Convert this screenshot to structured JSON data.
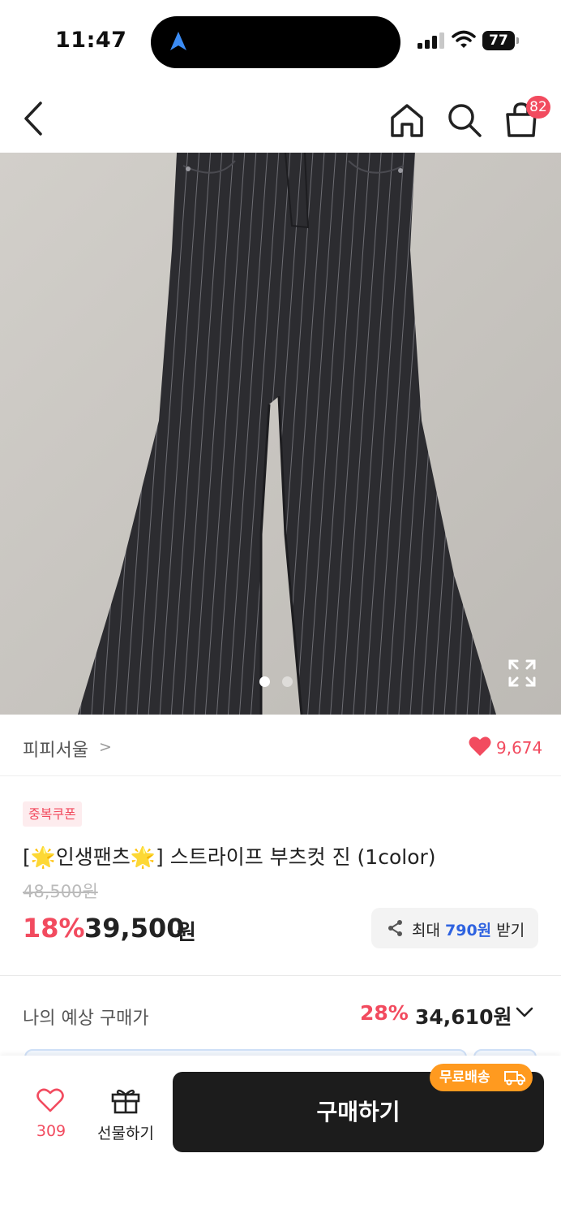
{
  "status_bar": {
    "time": "11:47",
    "battery": "77",
    "icons": [
      "location-arrow-icon",
      "signal-icon",
      "wifi-icon",
      "battery-icon"
    ]
  },
  "nav": {
    "icons": [
      "back-chevron-icon",
      "home-icon",
      "search-icon",
      "shopping-bag-icon"
    ],
    "cart_count": "82"
  },
  "gallery": {
    "total_images": 2,
    "current_index": 1,
    "icons": [
      "expand-icon"
    ]
  },
  "seller": {
    "name": "피피서울",
    "chevron": ">",
    "like_count": "9,674"
  },
  "product": {
    "coupon_badge": "중복쿠폰",
    "title": "[🌟인생팬츠🌟] 스트라이프 부츠컷 진 (1color)",
    "original_price": "48,500원",
    "discount_rate": "18%",
    "sale_price": "39,500",
    "sale_unit": "원"
  },
  "share": {
    "prefix": "최대",
    "amount": "790원",
    "suffix": "받기"
  },
  "expected": {
    "label": "나의 예상 구매가",
    "rate": "28%",
    "price": "34,610원"
  },
  "bottom_bar": {
    "like_count": "309",
    "gift_label": "선물하기",
    "buy_label": "구매하기",
    "free_shipping": "무료배송"
  },
  "colors": {
    "accent": "#f24b5f",
    "blue": "#2f63e0",
    "buy_button": "#1c1c1c",
    "free_shipping": "#ff9a1f"
  }
}
